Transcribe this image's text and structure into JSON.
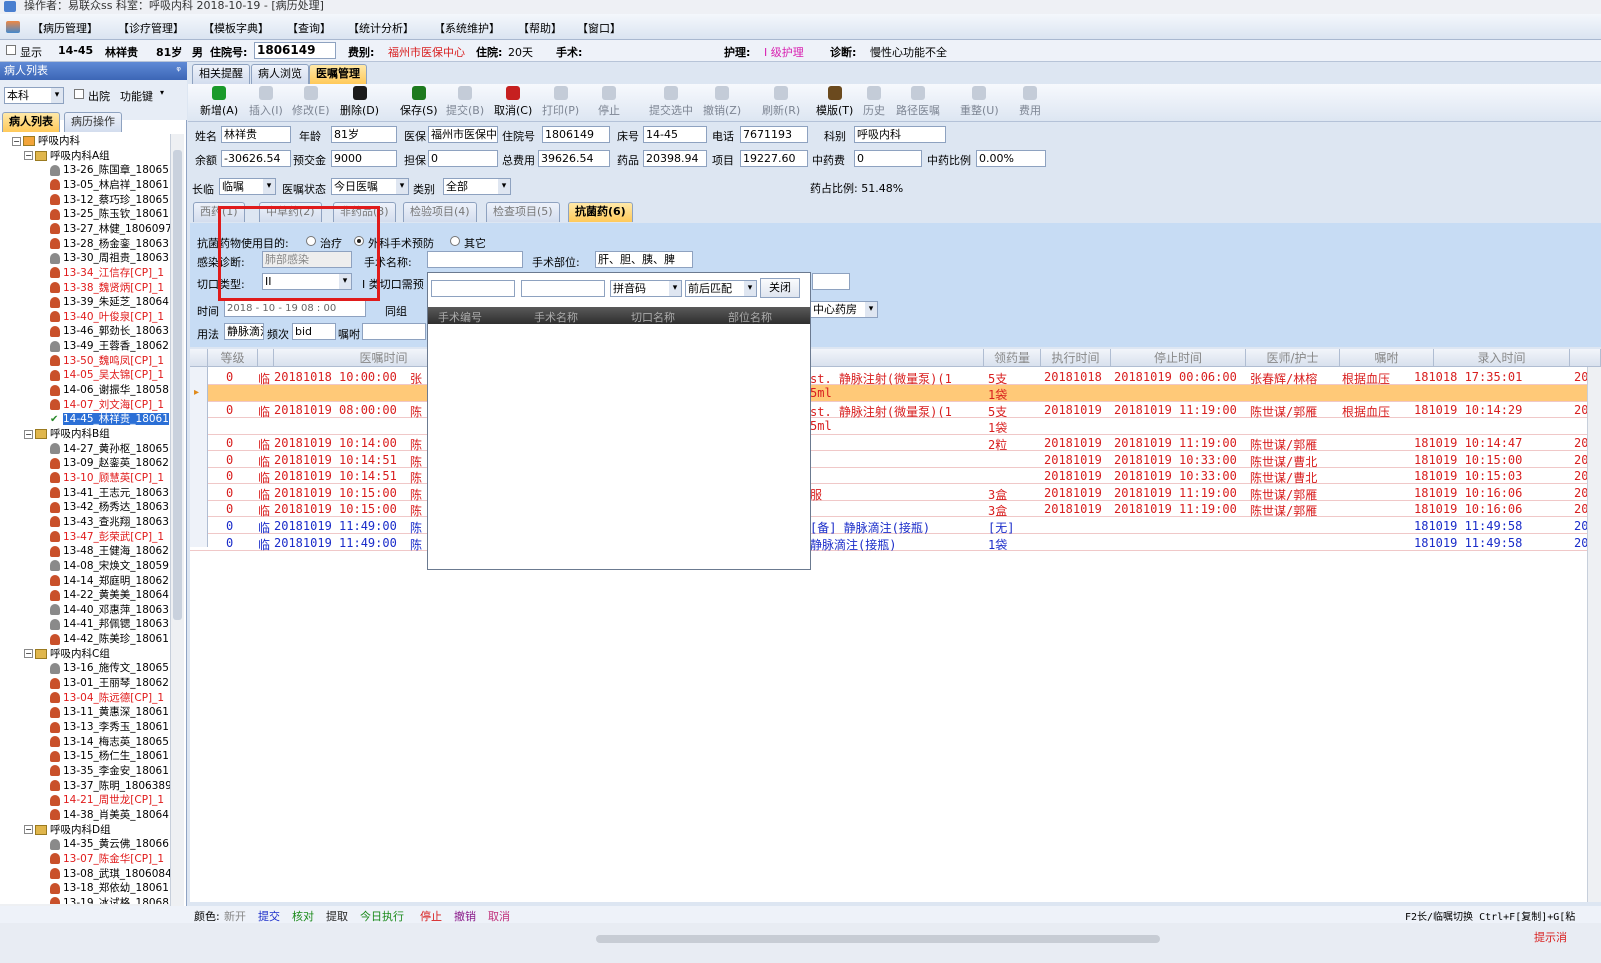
{
  "titlebar": {
    "text": "操作者：易联众ss  科室：呼吸内科  2018-10-19 - [病历处理]"
  },
  "menu": [
    "【病历管理】",
    "【诊疗管理】",
    "【模板字典】",
    "【查询】",
    "【统计分析】",
    "【系统维护】",
    "【帮助】",
    "【窗口】"
  ],
  "info": {
    "show": "显示",
    "bed": "14-45",
    "name": "林祥贵",
    "age": "81岁",
    "sex": "男",
    "inpatient_label": "住院号:",
    "inpatient_no": "1806149",
    "category_label": "费别:",
    "category": "福州市医保中心",
    "stay_label": "住院:",
    "stay": "20天",
    "surgery_label": "手术:",
    "nursing_label": "护理:",
    "nursing": "I 级护理",
    "diagnosis_label": "诊断:",
    "diagnosis": "慢性心功能不全"
  },
  "left": {
    "title": "病人列表",
    "scope": "本科",
    "discharged": "出院",
    "function": "功能键",
    "tabs": [
      "病人列表",
      "病历操作"
    ],
    "tree": [
      {
        "type": "dept",
        "text": "呼吸内科"
      },
      {
        "type": "group",
        "text": "呼吸内科A组"
      },
      {
        "text": "13-26_陈国章_18065",
        "color": "black",
        "icon": "gray"
      },
      {
        "text": "13-05_林启祥_18061",
        "color": "black",
        "icon": "red"
      },
      {
        "text": "13-12_蔡巧珍_18065",
        "color": "black",
        "icon": "red"
      },
      {
        "text": "13-25_陈玉钦_18061",
        "color": "black",
        "icon": "red"
      },
      {
        "text": "13-27_林健_1806097",
        "color": "black",
        "icon": "red"
      },
      {
        "text": "13-28_杨金銮_18063",
        "color": "black",
        "icon": "red"
      },
      {
        "text": "13-30_周祖贵_18063",
        "color": "black",
        "icon": "gray"
      },
      {
        "text": "13-34_江信存[CP]_1",
        "color": "red",
        "icon": "red"
      },
      {
        "text": "13-38_魏贤炳[CP]_1",
        "color": "red",
        "icon": "red"
      },
      {
        "text": "13-39_朱延芝_18064",
        "color": "black",
        "icon": "red"
      },
      {
        "text": "13-40_叶俊泉[CP]_1",
        "color": "red",
        "icon": "red"
      },
      {
        "text": "13-46_郭劲长_18063",
        "color": "black",
        "icon": "red"
      },
      {
        "text": "13-49_王蓉香_18062",
        "color": "black",
        "icon": "gray"
      },
      {
        "text": "13-50_魏鸣凤[CP]_1",
        "color": "red",
        "icon": "red"
      },
      {
        "text": "14-05_吴太锦[CP]_1",
        "color": "red",
        "icon": "red"
      },
      {
        "text": "14-06_谢振华_18058",
        "color": "black",
        "icon": "red"
      },
      {
        "text": "14-07_刘文海[CP]_1",
        "color": "red",
        "icon": "red"
      },
      {
        "text": "14-45_林祥贵_18061",
        "color": "selected",
        "icon": "check"
      },
      {
        "type": "group",
        "text": "呼吸内科B组"
      },
      {
        "text": "14-27_黄孙枢_18065",
        "color": "black",
        "icon": "gray"
      },
      {
        "text": "13-09_赵銮英_18062",
        "color": "black",
        "icon": "red"
      },
      {
        "text": "13-10_顾慧英[CP]_1",
        "color": "red",
        "icon": "red"
      },
      {
        "text": "13-41_王志元_18063",
        "color": "black",
        "icon": "red"
      },
      {
        "text": "13-42_杨秀达_18063",
        "color": "black",
        "icon": "red"
      },
      {
        "text": "13-43_查兆翔_18063",
        "color": "black",
        "icon": "red"
      },
      {
        "text": "13-47_彭荣武[CP]_1",
        "color": "red",
        "icon": "red"
      },
      {
        "text": "13-48_王健海_18062",
        "color": "black",
        "icon": "red"
      },
      {
        "text": "14-08_宋焕文_18059",
        "color": "black",
        "icon": "gray"
      },
      {
        "text": "14-14_郑庭明_18062",
        "color": "black",
        "icon": "red"
      },
      {
        "text": "14-22_黄美美_18064",
        "color": "black",
        "icon": "red"
      },
      {
        "text": "14-40_邓惠萍_18063",
        "color": "black",
        "icon": "gray"
      },
      {
        "text": "14-41_邦佩锶_18063",
        "color": "black",
        "icon": "gray"
      },
      {
        "text": "14-42_陈美珍_18061",
        "color": "black",
        "icon": "red"
      },
      {
        "type": "group",
        "text": "呼吸内科C组"
      },
      {
        "text": "13-16_施传文_18065",
        "color": "black",
        "icon": "gray"
      },
      {
        "text": "13-01_王丽琴_18062",
        "color": "black",
        "icon": "red"
      },
      {
        "text": "13-04_陈远德[CP]_1",
        "color": "red",
        "icon": "red"
      },
      {
        "text": "13-11_黄惠深_18061",
        "color": "black",
        "icon": "red"
      },
      {
        "text": "13-13_李秀玉_18061",
        "color": "black",
        "icon": "red"
      },
      {
        "text": "13-14_梅志英_18065",
        "color": "black",
        "icon": "red"
      },
      {
        "text": "13-15_杨仁生_18061",
        "color": "black",
        "icon": "red"
      },
      {
        "text": "13-35_李金安_18061",
        "color": "black",
        "icon": "red"
      },
      {
        "text": "13-37_陈明_1806389",
        "color": "black",
        "icon": "red"
      },
      {
        "text": "14-21_周世龙[CP]_1",
        "color": "red",
        "icon": "red"
      },
      {
        "text": "14-38_肖美英_18064",
        "color": "black",
        "icon": "red"
      },
      {
        "type": "group",
        "text": "呼吸内科D组"
      },
      {
        "text": "14-35_黄云佛_18066",
        "color": "black",
        "icon": "gray"
      },
      {
        "text": "13-07_陈金华[CP]_1",
        "color": "red",
        "icon": "red"
      },
      {
        "text": "13-08_武琪_1806084",
        "color": "black",
        "icon": "red"
      },
      {
        "text": "13-18_郑依幼_18061",
        "color": "black",
        "icon": "red"
      },
      {
        "text": "13-19_冰试格_18068",
        "color": "black",
        "icon": "red"
      }
    ]
  },
  "topTabs": [
    "相关提醒",
    "病人浏览",
    "医嘱管理"
  ],
  "toolbar": [
    {
      "label": "新增(A)",
      "on": true,
      "color": "#1a9a2a"
    },
    {
      "label": "插入(I)",
      "on": false
    },
    {
      "label": "修改(E)",
      "on": false
    },
    {
      "label": "删除(D)",
      "on": true,
      "color": "#1a1a1a"
    },
    {
      "label": "保存(S)",
      "on": true,
      "color": "#1e7a1e"
    },
    {
      "label": "提交(B)",
      "on": false
    },
    {
      "label": "取消(C)",
      "on": true,
      "color": "#c62020"
    },
    {
      "label": "打印(P)",
      "on": false
    },
    {
      "label": "停止",
      "on": false
    },
    {
      "label": "提交选中",
      "on": false
    },
    {
      "label": "撤销(Z)",
      "on": false
    },
    {
      "label": "刷新(R)",
      "on": false
    },
    {
      "label": "模版(T)",
      "on": true,
      "color": "#6b4a1e"
    },
    {
      "label": "历史",
      "on": false
    },
    {
      "label": "路径医嘱",
      "on": false
    },
    {
      "label": "重整(U)",
      "on": false
    },
    {
      "label": "费用",
      "on": false
    }
  ],
  "patient": {
    "name_l": "姓名",
    "name": "林祥贵",
    "age_l": "年龄",
    "age": "81岁",
    "ins_l": "医保",
    "ins": "福州市医保中",
    "inp_l": "住院号",
    "inp": "1806149",
    "bed_l": "床号",
    "bed": "14-45",
    "tel_l": "电话",
    "tel": "7671193",
    "dept_l": "科别",
    "dept": "呼吸内科",
    "bal_l": "余额",
    "bal": "-30626.54",
    "dep_l": "预交金",
    "dep": "9000",
    "gua_l": "担保",
    "gua": "0",
    "tot_l": "总费用",
    "tot": "39626.54",
    "drug_l": "药品",
    "drug": "20398.94",
    "item_l": "项目",
    "item": "19227.60",
    "herb_l": "中药费",
    "herb": "0",
    "herbr_l": "中药比例",
    "herbr": "0.00%"
  },
  "filter": {
    "type_l": "长临",
    "type": "临嘱",
    "status_l": "医嘱状态",
    "status": "今日医嘱",
    "cat_l": "类别",
    "cat": "全部",
    "ratio": "药占比例: 51.48%"
  },
  "subTabs": [
    "西药(1)",
    "中草药(2)",
    "非药品(3)",
    "检验项目(4)",
    "检查项目(5)",
    "抗菌药(6)"
  ],
  "anti": {
    "purpose_l": "抗菌药物使用目的:",
    "opt1": "治疗",
    "opt2": "外科手术预防",
    "opt3": "其它",
    "infect_l": "感染诊断:",
    "infect": "肺部感染",
    "surg_l": "手术名称:",
    "site_l": "手术部位:",
    "site": "肝、胆、胰、脾",
    "cut_l": "切口类型:",
    "cut": "II",
    "cut2_l": "I 类切口需预",
    "time_l": "时间",
    "time": "2018 - 10 - 19   08 : 00",
    "same": "同组",
    "use_l": "用法",
    "use": "静脉滴注",
    "freq_l": "频次",
    "freq": "bid",
    "note_l": "嘱咐",
    "pharm": "中心药房"
  },
  "popup": {
    "match1": "拼音码",
    "match2": "前后匹配",
    "close": "关闭",
    "cols": [
      "手术编号",
      "手术名称",
      "切口名称",
      "部位名称"
    ]
  },
  "grid": {
    "headers": [
      "等级",
      "医嘱时间",
      "",
      "领药量",
      "执行时间",
      "停止时间",
      "医师/护士",
      "嘱咐",
      "录入时间"
    ],
    "rows": [
      {
        "lv": "0",
        "k": "临",
        "t": "20181018 10:00:00",
        "c": "张",
        "rt": "st.  静脉注射(微量泵)(1",
        "q": "5支",
        "e": "20181018",
        "s": "20181019 00:06:00",
        "d": "张春辉/林榕",
        "z": "根据血压",
        "r": "181018 17:35:01",
        "color": "red",
        "hl": false
      },
      {
        "lv": "",
        "k": "",
        "t": "",
        "c": "",
        "rt": "5ml",
        "q": "1袋",
        "e": "",
        "s": "",
        "d": "",
        "z": "",
        "r": "",
        "color": "red",
        "hl": true
      },
      {
        "lv": "0",
        "k": "临",
        "t": "20181019 08:00:00",
        "c": "陈",
        "rt": "st.  静脉注射(微量泵)(1",
        "q": "5支",
        "e": "20181019",
        "s": "20181019 11:19:00",
        "d": "陈世谋/郭雁",
        "z": "根据血压",
        "r": "181019 10:14:29",
        "color": "red",
        "hl": false
      },
      {
        "lv": "",
        "k": "",
        "t": "",
        "c": "",
        "rt": "5ml",
        "q": "1袋",
        "e": "",
        "s": "",
        "d": "",
        "z": "",
        "r": "",
        "color": "red",
        "hl": false
      },
      {
        "lv": "0",
        "k": "临",
        "t": "20181019 10:14:00",
        "c": "陈",
        "rt": "",
        "q": "2粒",
        "e": "20181019",
        "s": "20181019 11:19:00",
        "d": "陈世谋/郭雁",
        "z": "",
        "r": "181019 10:14:47",
        "color": "red",
        "hl": false
      },
      {
        "lv": "0",
        "k": "临",
        "t": "20181019 10:14:51",
        "c": "陈",
        "rt": "",
        "q": "",
        "e": "20181019",
        "s": "20181019 10:33:00",
        "d": "陈世谋/曹北",
        "z": "",
        "r": "181019 10:15:00",
        "color": "red",
        "hl": false
      },
      {
        "lv": "0",
        "k": "临",
        "t": "20181019 10:14:51",
        "c": "陈",
        "rt": "",
        "q": "",
        "e": "20181019",
        "s": "20181019 10:33:00",
        "d": "陈世谋/曹北",
        "z": "",
        "r": "181019 10:15:03",
        "color": "red",
        "hl": false
      },
      {
        "lv": "0",
        "k": "临",
        "t": "20181019 10:15:00",
        "c": "陈",
        "rt": "服",
        "q": "3盒",
        "e": "20181019",
        "s": "20181019 11:19:00",
        "d": "陈世谋/郭雁",
        "z": "",
        "r": "181019 10:16:06",
        "color": "red",
        "hl": false
      },
      {
        "lv": "0",
        "k": "临",
        "t": "20181019 10:15:00",
        "c": "陈",
        "rt": "",
        "q": "3盒",
        "e": "20181019",
        "s": "20181019 11:19:00",
        "d": "陈世谋/郭雁",
        "z": "",
        "r": "181019 10:16:06",
        "color": "red",
        "hl": false
      },
      {
        "lv": "0",
        "k": "临",
        "t": "20181019 11:49:00",
        "c": "陈",
        "rt": "[备] 静脉滴注(接瓶)",
        "q": "[无]",
        "e": "",
        "s": "",
        "d": "",
        "z": "",
        "r": "181019 11:49:58",
        "color": "blue",
        "hl": false
      },
      {
        "lv": "0",
        "k": "临",
        "t": "20181019 11:49:00",
        "c": "陈",
        "rt": "静脉滴注(接瓶)",
        "q": "1袋",
        "e": "",
        "s": "",
        "d": "",
        "z": "",
        "r": "181019 11:49:58",
        "color": "blue",
        "hl": false
      }
    ]
  },
  "legend": {
    "label": "颜色:",
    "items": [
      {
        "t": "新开",
        "c": "#888888"
      },
      {
        "t": "提交",
        "c": "#1a2cc9"
      },
      {
        "t": "核对",
        "c": "#1a8a1a"
      },
      {
        "t": "提取",
        "c": "#222222"
      },
      {
        "t": "今日执行",
        "c": "#1a8a1a"
      },
      {
        "t": "停止",
        "c": "#d81e1e"
      },
      {
        "t": "撤销",
        "c": "#8a1a8a"
      },
      {
        "t": "取消",
        "c": "#c0307a"
      }
    ],
    "hint": "F2长/临嘱切换 Ctrl+F[复制]+G[粘"
  },
  "bottom": {
    "tip": "提示消"
  }
}
